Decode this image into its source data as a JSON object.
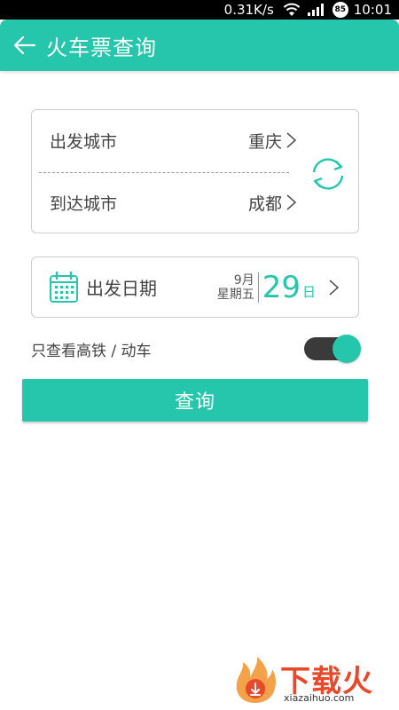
{
  "status_bar": {
    "speed": "0.31K/s",
    "battery": "85",
    "time": "10:01"
  },
  "header": {
    "title": "火车票查询"
  },
  "cities": {
    "from_label": "出发城市",
    "from_value": "重庆",
    "to_label": "到达城市",
    "to_value": "成都"
  },
  "date": {
    "label": "出发日期",
    "month": "9月",
    "weekday": "星期五",
    "day": "29",
    "day_unit": "日"
  },
  "filter": {
    "label": "只查看高铁 / 动车",
    "enabled": true
  },
  "query_button": {
    "label": "查询"
  },
  "watermark": {
    "brand": "下载火",
    "domain": "xiazaihuo.com"
  },
  "colors": {
    "accent": "#26c6ac",
    "toggle_track": "#3a3a3a",
    "watermark": "#e8492b"
  }
}
